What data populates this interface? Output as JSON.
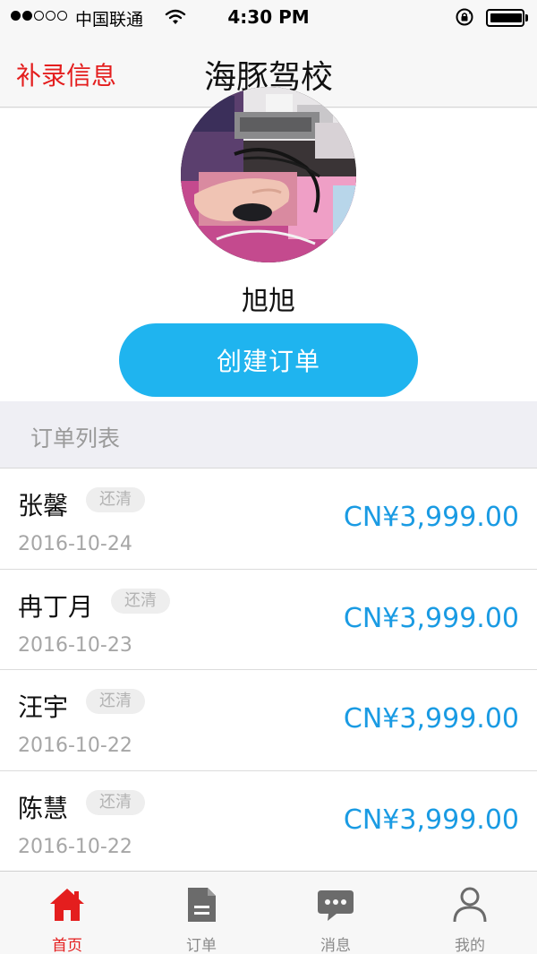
{
  "status_bar": {
    "carrier": "中国联通",
    "time": "4:30 PM",
    "signal_dots": [
      true,
      true,
      false,
      false,
      false
    ]
  },
  "nav": {
    "left_action": "补录信息",
    "title": "海豚驾校"
  },
  "profile": {
    "name": "旭旭",
    "create_button": "创建订单"
  },
  "section_header": "订单列表",
  "orders": [
    {
      "name": "张馨",
      "badge": "还清",
      "date": "2016-10-24",
      "amount": "CN¥3,999.00"
    },
    {
      "name": "冉丁月",
      "badge": "还清",
      "date": "2016-10-23",
      "amount": "CN¥3,999.00"
    },
    {
      "name": "汪宇",
      "badge": "还清",
      "date": "2016-10-22",
      "amount": "CN¥3,999.00"
    },
    {
      "name": "陈慧",
      "badge": "还清",
      "date": "2016-10-22",
      "amount": "CN¥3,999.00"
    }
  ],
  "tabs": [
    {
      "label": "首页",
      "icon": "home-icon",
      "active": true
    },
    {
      "label": "订单",
      "icon": "document-icon",
      "active": false
    },
    {
      "label": "消息",
      "icon": "chat-bubble-icon",
      "active": false
    },
    {
      "label": "我的",
      "icon": "person-icon",
      "active": false
    }
  ],
  "colors": {
    "accent_red": "#e41e1e",
    "button_blue": "#1fb4ef",
    "amount_blue": "#1a9be3"
  }
}
